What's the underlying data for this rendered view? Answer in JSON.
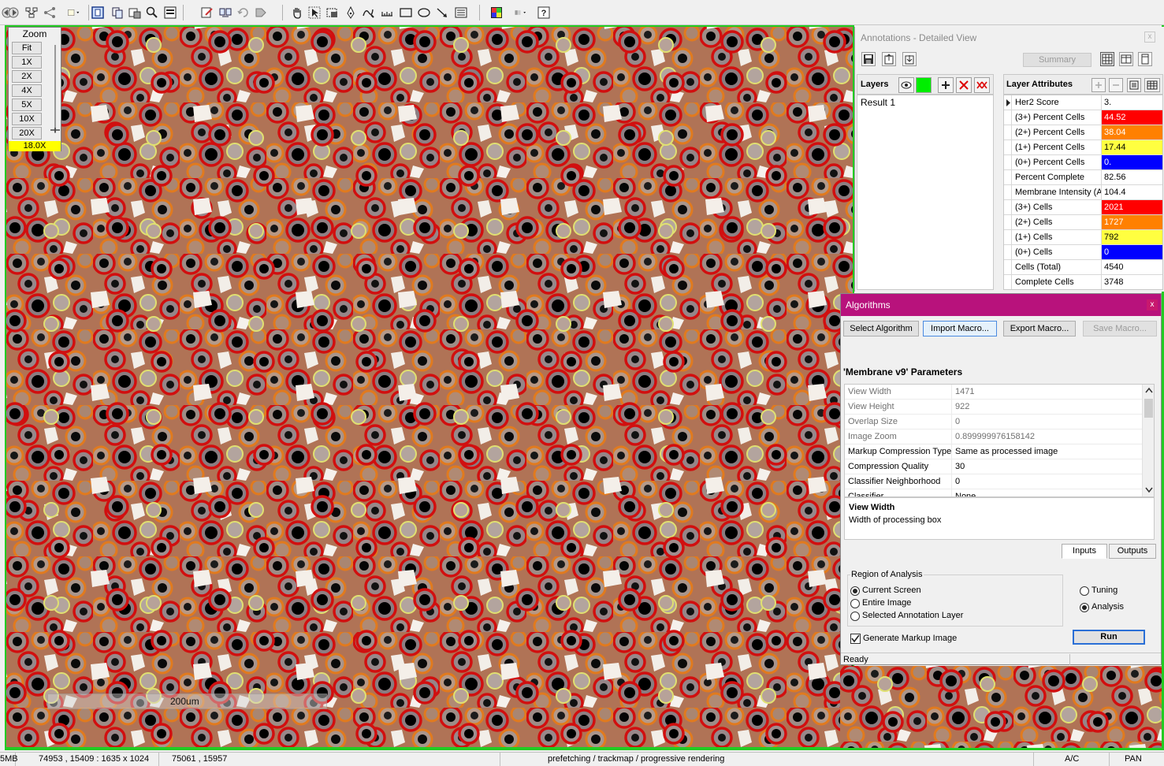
{
  "viewer": {
    "zoom": {
      "title": "Zoom",
      "buttons": [
        "Fit",
        "1X",
        "2X",
        "4X",
        "5X",
        "10X",
        "20X"
      ],
      "current": "18.0X"
    },
    "scale_bar": "200um"
  },
  "annotations": {
    "title": "Annotations - Detailed View",
    "close": "x",
    "summary_button": "Summary",
    "layers": {
      "label": "Layers",
      "items": [
        "Result 1"
      ]
    },
    "layer_attributes": {
      "label": "Layer Attributes",
      "rows": [
        {
          "name": "Her2 Score",
          "value": "3.",
          "color": ""
        },
        {
          "name": "(3+) Percent Cells",
          "value": "44.52",
          "color": "#ff0000"
        },
        {
          "name": "(2+) Percent Cells",
          "value": "38.04",
          "color": "#ff8000"
        },
        {
          "name": "(1+) Percent Cells",
          "value": "17.44",
          "color": "#ffff40"
        },
        {
          "name": "(0+) Percent Cells",
          "value": "0.",
          "color": "#0000ff"
        },
        {
          "name": "Percent Complete",
          "value": "82.56",
          "color": ""
        },
        {
          "name": "Membrane Intensity (A",
          "value": "104.4",
          "color": ""
        },
        {
          "name": "(3+) Cells",
          "value": "2021",
          "color": "#ff0000"
        },
        {
          "name": "(2+) Cells",
          "value": "1727",
          "color": "#ff8000"
        },
        {
          "name": "(1+) Cells",
          "value": "792",
          "color": "#ffff40"
        },
        {
          "name": "(0+) Cells",
          "value": "0",
          "color": "#0000ff"
        },
        {
          "name": "Cells (Total)",
          "value": "4540",
          "color": ""
        },
        {
          "name": "Complete Cells",
          "value": "3748",
          "color": ""
        }
      ]
    }
  },
  "algorithms": {
    "title": "Algorithms",
    "close": "x",
    "buttons": {
      "select": "Select Algorithm",
      "import": "Import Macro...",
      "export": "Export Macro...",
      "save": "Save Macro..."
    },
    "parameters_title": "'Membrane v9'  Parameters",
    "parameters": [
      {
        "name": "View Width",
        "value": "1471"
      },
      {
        "name": "View Height",
        "value": "922"
      },
      {
        "name": "Overlap Size",
        "value": "0"
      },
      {
        "name": "Image Zoom",
        "value": "0.899999976158142"
      },
      {
        "name": "Markup Compression Type",
        "value": "Same as processed image"
      },
      {
        "name": "Compression Quality",
        "value": "30"
      },
      {
        "name": "Classifier Neighborhood",
        "value": "0"
      },
      {
        "name": "Classifier",
        "value": "None"
      }
    ],
    "description": {
      "title": "View Width",
      "text": "Width of processing box"
    },
    "tabs": {
      "inputs": "Inputs",
      "outputs": "Outputs"
    },
    "region": {
      "label": "Region of Analysis",
      "options": [
        "Current Screen",
        "Entire Image",
        "Selected Annotation Layer"
      ],
      "selected": "Current Screen"
    },
    "mode": {
      "options": [
        "Tuning",
        "Analysis"
      ],
      "selected": "Analysis"
    },
    "generate_markup": "Generate Markup Image",
    "run": "Run",
    "status": "Ready"
  },
  "statusbar": {
    "memory": "5MB",
    "region": "74953 , 15409 : 1635 x 1024",
    "cursor": "75061 , 15957",
    "message": "prefetching / trackmap / progressive rendering",
    "ac": "A/C",
    "mode": "PAN"
  },
  "colors": {
    "accent_green": "#22cc22",
    "alg_title": "#b8127c",
    "zoom_highlight": "#ffff00"
  }
}
